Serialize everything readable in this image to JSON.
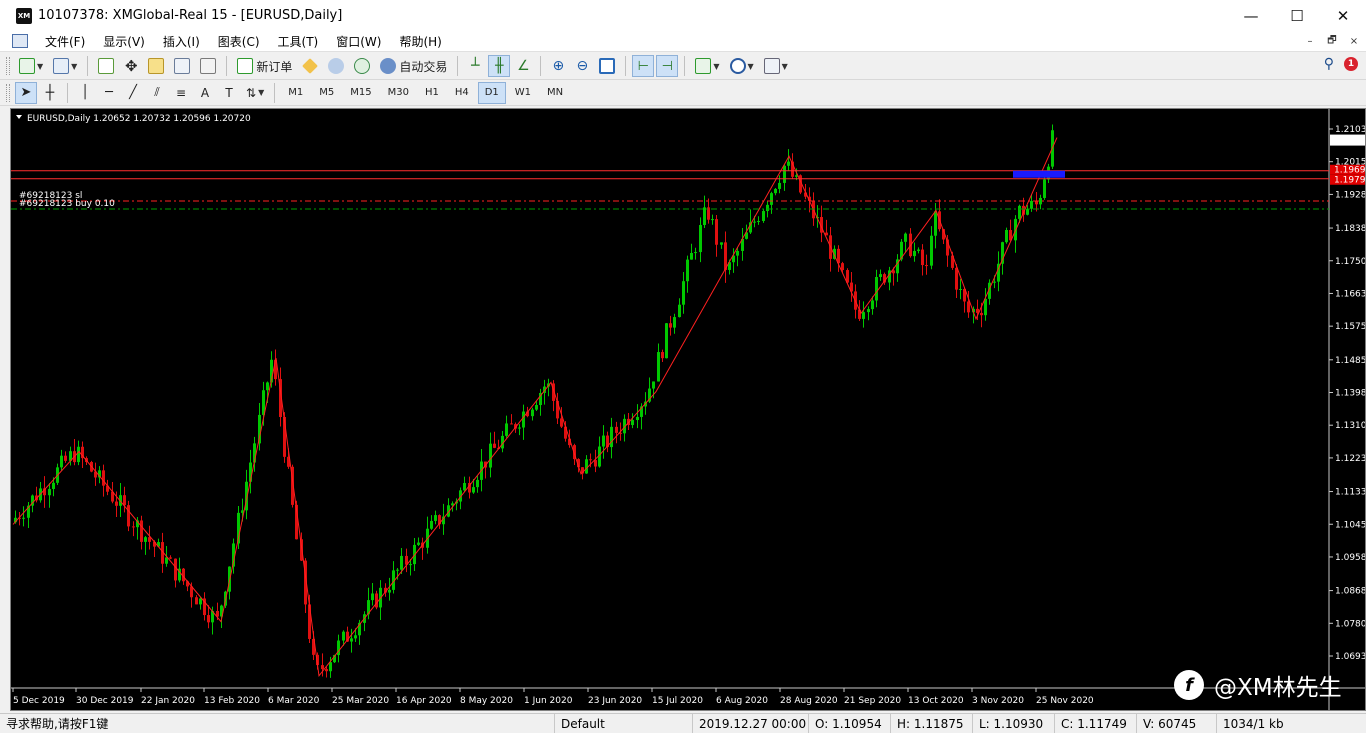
{
  "window": {
    "title": "10107378: XMGlobal-Real 15 - [EURUSD,Daily]",
    "logo_text": "XM",
    "minimize": "—",
    "maximize": "☐",
    "close": "✕"
  },
  "menu": {
    "items": [
      "文件(F)",
      "显示(V)",
      "插入(I)",
      "图表(C)",
      "工具(T)",
      "窗口(W)",
      "帮助(H)"
    ],
    "mdi": [
      "–",
      "🗗",
      "×"
    ]
  },
  "toolbar": {
    "new_order": "新订单",
    "auto_trade": "自动交易",
    "notification_count": "1"
  },
  "timeframes": [
    "M1",
    "M5",
    "M15",
    "M30",
    "H1",
    "H4",
    "D1",
    "W1",
    "MN"
  ],
  "active_timeframe": "D1",
  "chart": {
    "header": "EURUSD,Daily  1.20652 1.20732 1.20596 1.20720",
    "order_sl_label": "#69218123 sl",
    "order_buy_label": "#69218123 buy 0.10",
    "current_price": "1.20720",
    "tag_red_1": "1.19699",
    "tag_red_2": "1.19797",
    "price_ticks": [
      "1.21030",
      "1.20155",
      "1.19280",
      "1.18380",
      "1.17505",
      "1.16630",
      "1.15755",
      "1.14855",
      "1.13980",
      "1.13105",
      "1.12230",
      "1.11330",
      "1.10455",
      "1.09580",
      "1.08680",
      "1.07805",
      "1.06930"
    ],
    "date_ticks": [
      "5 Dec 2019",
      "30 Dec 2019",
      "22 Jan 2020",
      "13 Feb 2020",
      "6 Mar 2020",
      "25 Mar 2020",
      "16 Apr 2020",
      "8 May 2020",
      "1 Jun 2020",
      "23 Jun 2020",
      "15 Jul 2020",
      "6 Aug 2020",
      "28 Aug 2020",
      "21 Sep 2020",
      "13 Oct 2020",
      "3 Nov 2020",
      "25 Nov 2020"
    ],
    "colors": {
      "bull": "#00c800",
      "bear": "#e01010",
      "zigzag": "#ff2020",
      "level": "#ff3030",
      "sl_line": "#ff2020",
      "buy_line": "#00a000",
      "zone": "#1a1aff"
    }
  },
  "status": {
    "help": "寻求帮助,请按F1键",
    "profile": "Default",
    "datetime": "2019.12.27 00:00",
    "open": "O: 1.10954",
    "high": "H: 1.11875",
    "low": "L: 1.10930",
    "close": "C: 1.11749",
    "volume": "V: 60745",
    "traffic": "1034/1 kb"
  },
  "watermark": {
    "text": "@XM林先生"
  }
}
